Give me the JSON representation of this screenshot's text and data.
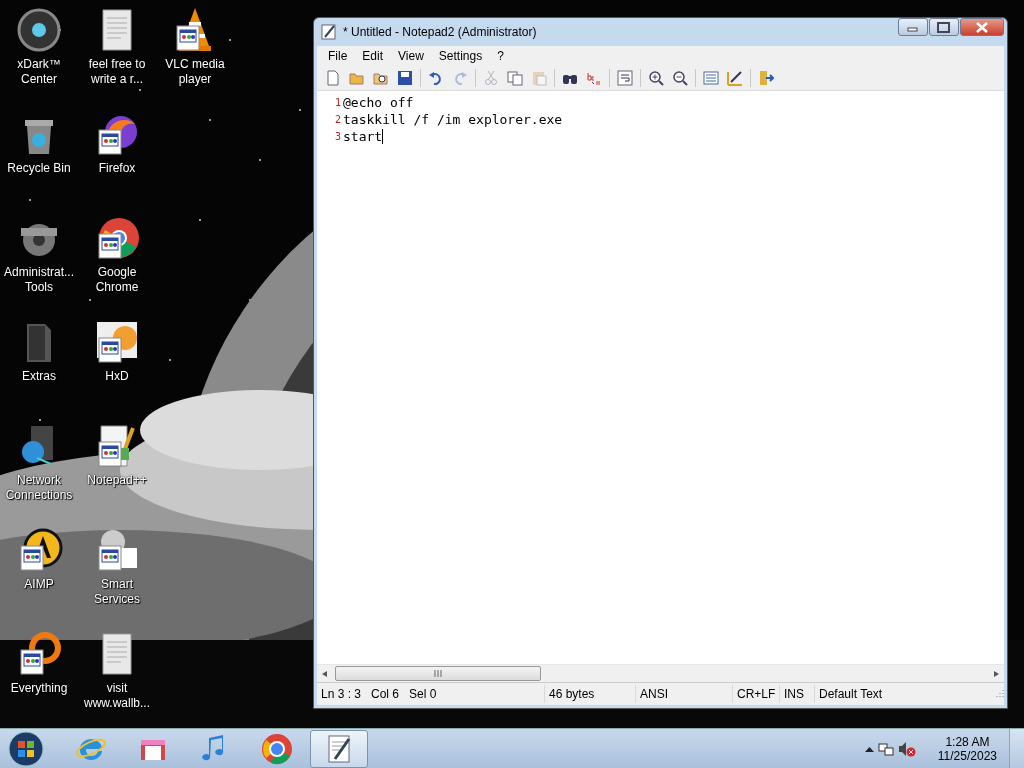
{
  "desktop_icons": [
    {
      "label": "xDark™ Center",
      "kind": "orb",
      "overlay": false
    },
    {
      "label": "Recycle Bin",
      "kind": "bin",
      "overlay": false
    },
    {
      "label": "Administrat... Tools",
      "kind": "gear",
      "overlay": false
    },
    {
      "label": "Extras",
      "kind": "folder",
      "overlay": false
    },
    {
      "label": "Network Connections",
      "kind": "network",
      "overlay": false
    },
    {
      "label": "AIMP",
      "kind": "aimp",
      "overlay": true
    },
    {
      "label": "Everything",
      "kind": "ring",
      "overlay": true
    },
    {
      "label": "feel free to write a r...",
      "kind": "document",
      "overlay": false
    },
    {
      "label": "Firefox",
      "kind": "flame",
      "overlay": true
    },
    {
      "label": "Google Chrome",
      "kind": "chrome",
      "overlay": true
    },
    {
      "label": "HxD",
      "kind": "hex",
      "overlay": true
    },
    {
      "label": "Notepad++",
      "kind": "notepad",
      "overlay": true
    },
    {
      "label": "Smart Services",
      "kind": "services",
      "overlay": true
    },
    {
      "label": "visit www.wallb...",
      "kind": "document",
      "overlay": false
    },
    {
      "label": "VLC media player",
      "kind": "cone",
      "overlay": true
    }
  ],
  "window": {
    "title": "* Untitled - Notepad2 (Administrator)",
    "menu": [
      "File",
      "Edit",
      "View",
      "Settings",
      "?"
    ],
    "toolbar": [
      [
        {
          "kind": "new",
          "disabled": false
        },
        {
          "kind": "open",
          "disabled": false
        },
        {
          "kind": "browse",
          "disabled": false
        },
        {
          "kind": "save",
          "disabled": false
        }
      ],
      [
        {
          "kind": "undo",
          "disabled": false
        },
        {
          "kind": "redo",
          "disabled": true
        }
      ],
      [
        {
          "kind": "cut",
          "disabled": true
        },
        {
          "kind": "copy",
          "disabled": false
        },
        {
          "kind": "paste",
          "disabled": true
        }
      ],
      [
        {
          "kind": "find",
          "disabled": false
        },
        {
          "kind": "replace",
          "disabled": false
        }
      ],
      [
        {
          "kind": "wrap",
          "disabled": false
        }
      ],
      [
        {
          "kind": "zoom-in",
          "disabled": false
        },
        {
          "kind": "zoom-out",
          "disabled": false
        }
      ],
      [
        {
          "kind": "scheme",
          "disabled": false
        },
        {
          "kind": "customize",
          "disabled": false
        }
      ],
      [
        {
          "kind": "exit",
          "disabled": false
        }
      ]
    ],
    "lines": [
      {
        "number": "1",
        "text": "@echo off"
      },
      {
        "number": "2",
        "text": "taskkill /f /im explorer.exe"
      },
      {
        "number": "3",
        "text": "start",
        "caret": true
      }
    ],
    "status_bar": [
      "Ln 3 : 3   Col 6   Sel 0",
      "46 bytes",
      "ANSI",
      "CR+LF",
      "INS",
      "Default Text"
    ]
  },
  "taskbar": {
    "apps": [
      {
        "kind": "ie",
        "active": false
      },
      {
        "kind": "store",
        "active": false
      },
      {
        "kind": "music",
        "active": false
      },
      {
        "kind": "chrome",
        "active": false
      },
      {
        "kind": "notepad2",
        "active": true
      }
    ],
    "time": "1:28 AM",
    "date": "11/25/2023"
  }
}
